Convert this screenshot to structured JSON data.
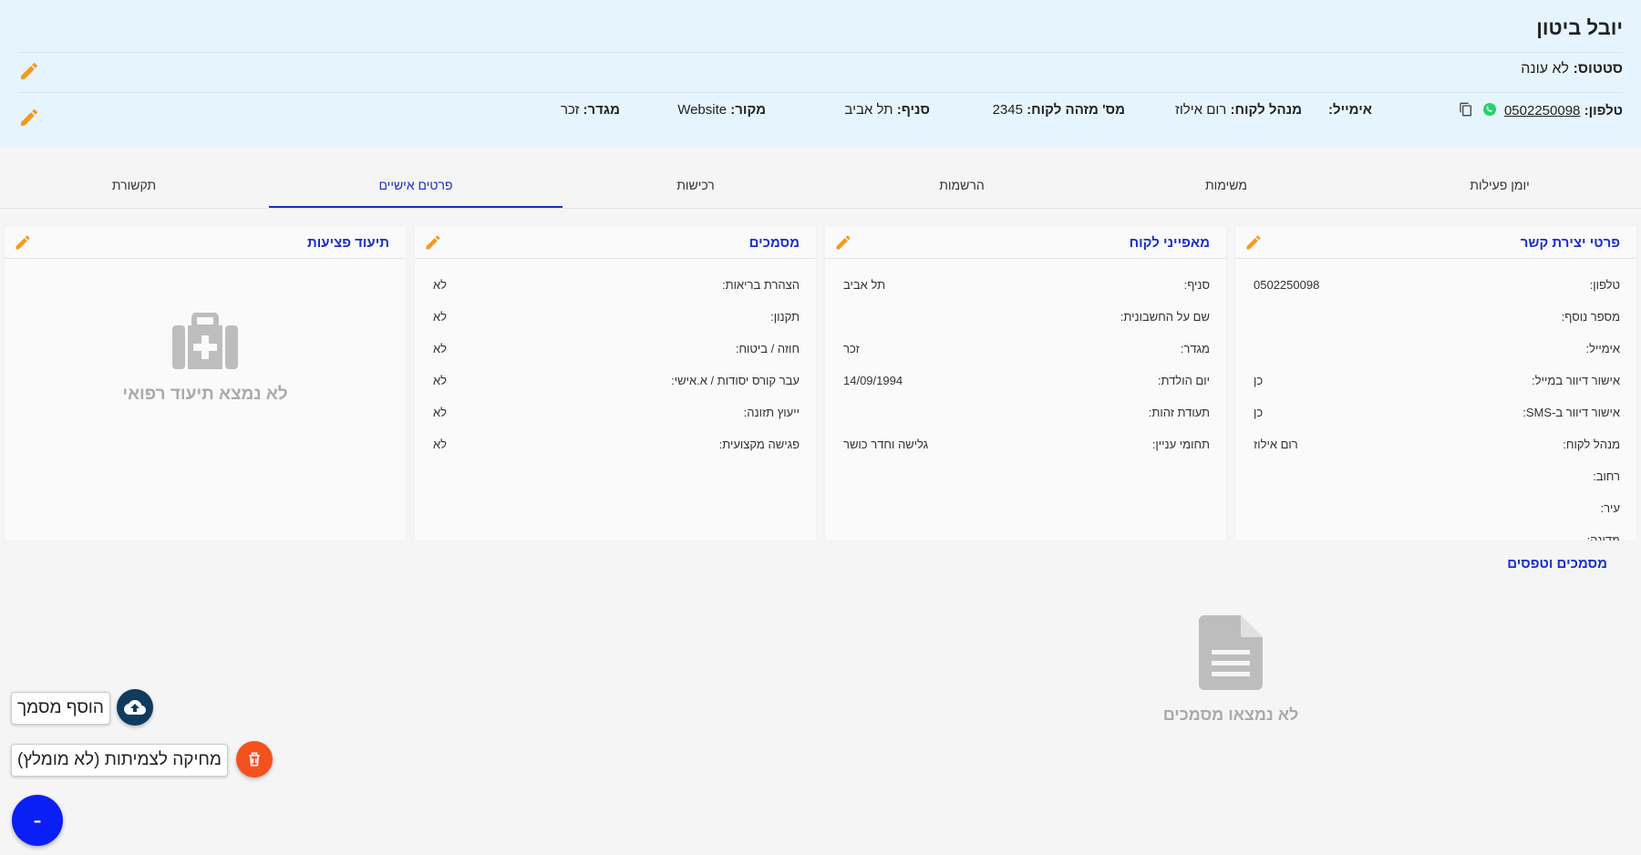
{
  "header": {
    "name": "יובל ביטון",
    "status_label": "סטטוס:",
    "status_value": "לא עונה",
    "phone_label": "טלפון:",
    "phone_value": "0502250098",
    "email_label": "אימייל:",
    "email_value": "",
    "manager_label": "מנהל לקוח:",
    "manager_value": "רום אילוז",
    "customer_id_label": "מס' מזהה לקוח:",
    "customer_id_value": "2345",
    "branch_label": "סניף:",
    "branch_value": "תל אביב",
    "source_label": "מקור:",
    "source_value": "Website",
    "gender_label": "מגדר:",
    "gender_value": "זכר"
  },
  "tabs": [
    {
      "label": "יומן פעילות"
    },
    {
      "label": "משימות"
    },
    {
      "label": "הרשמות"
    },
    {
      "label": "רכישות"
    },
    {
      "label": "פרטים אישיים"
    },
    {
      "label": "תקשורת"
    }
  ],
  "cards": {
    "contact": {
      "title": "פרטי יצירת קשר",
      "rows": [
        {
          "label": "טלפון:",
          "value": "0502250098"
        },
        {
          "label": "מספר נוסף:",
          "value": ""
        },
        {
          "label": "אימייל:",
          "value": ""
        },
        {
          "label": "אישור דיוור במייל:",
          "value": "כן"
        },
        {
          "label": "אישור דיוור ב-SMS:",
          "value": "כן"
        },
        {
          "label": "מנהל לקוח:",
          "value": "רום אילוז"
        },
        {
          "label": "רחוב:",
          "value": ""
        },
        {
          "label": "עיר:",
          "value": ""
        },
        {
          "label": "מדינה:",
          "value": ""
        }
      ]
    },
    "characteristics": {
      "title": "מאפייני לקוח",
      "rows": [
        {
          "label": "סניף:",
          "value": "תל אביב"
        },
        {
          "label": "שם על החשבונית:",
          "value": ""
        },
        {
          "label": "מגדר:",
          "value": "זכר"
        },
        {
          "label": "יום הולדת:",
          "value": "14/09/1994"
        },
        {
          "label": "תעודת זהות:",
          "value": ""
        },
        {
          "label": "תחומי עניין:",
          "value": "גלישה וחדר כושר"
        }
      ]
    },
    "documents": {
      "title": "מסמכים",
      "rows": [
        {
          "label": "הצהרת בריאות:",
          "value": "לא"
        },
        {
          "label": "תקנון:",
          "value": "לא"
        },
        {
          "label": "חוזה / ביטוח:",
          "value": "לא"
        },
        {
          "label": "עבר קורס יסודות / א.אישי:",
          "value": "לא"
        },
        {
          "label": "ייעוץ תזונה:",
          "value": "לא"
        },
        {
          "label": "פגישה מקצועית:",
          "value": "לא"
        }
      ]
    },
    "injuries": {
      "title": "תיעוד פציעות",
      "empty_text": "לא נמצא תיעוד רפואי",
      "icon": "medical-kit-icon"
    }
  },
  "docs_section": {
    "title": "מסמכים וטפסים",
    "empty_text": "לא נמצאו מסמכים",
    "icon": "document-icon"
  },
  "fab": {
    "add_document_label": "הוסף מסמך",
    "delete_forever_label": "מחיקה לצמיתות (לא מומלץ)",
    "main_symbol": "-"
  },
  "colors": {
    "accent": "#1a2ec9",
    "edit_icon": "#f39a1e",
    "header_bg": "#e6f4fd",
    "upload_fab": "#0f3b5f",
    "delete_fab": "#f4511e",
    "main_fab": "#0a1ff5",
    "whatsapp": "#25d366"
  }
}
